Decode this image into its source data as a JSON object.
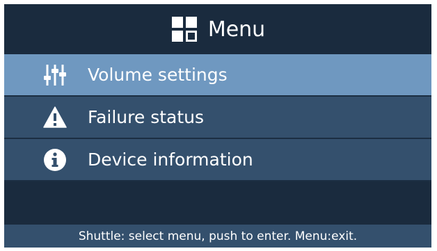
{
  "header": {
    "title": "Menu",
    "icon": "grid-menu-icon"
  },
  "menu": {
    "items": [
      {
        "label": "Volume settings",
        "icon": "sliders-icon",
        "selected": true
      },
      {
        "label": "Failure status",
        "icon": "warning-icon",
        "selected": false
      },
      {
        "label": "Device information",
        "icon": "info-icon",
        "selected": false
      }
    ]
  },
  "footer": {
    "hint": "Shuttle: select menu, push to enter. Menu:exit."
  },
  "colors": {
    "background": "#1a2b3e",
    "item_background": "#34506d",
    "selected_background": "#6f98c0",
    "text": "#ffffff"
  }
}
